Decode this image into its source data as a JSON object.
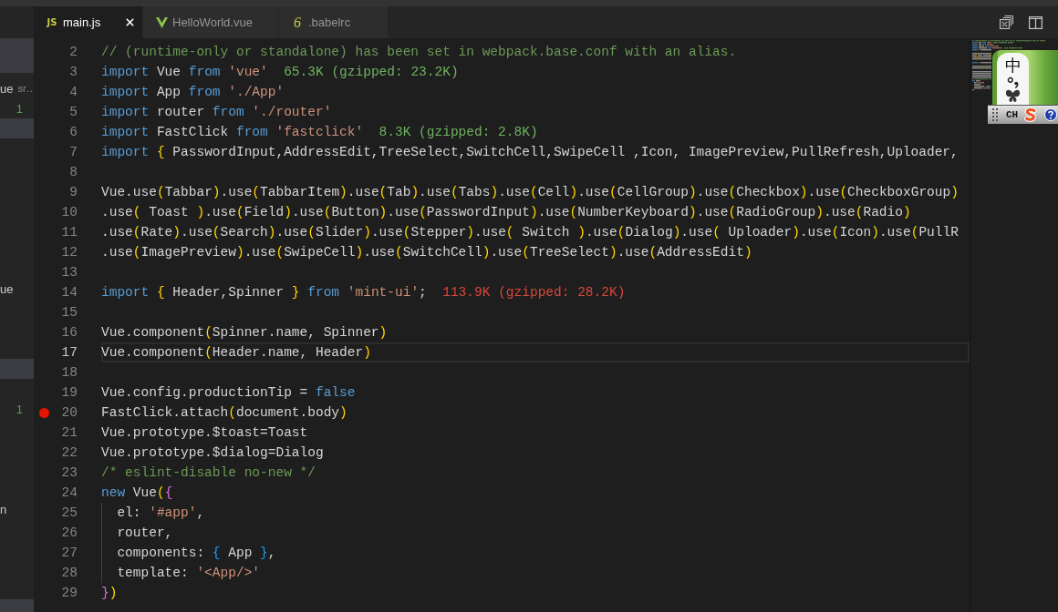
{
  "sidebar": {
    "items": [
      {
        "label": "ue",
        "detail": "sr…",
        "selected": false
      },
      {
        "count": "1",
        "selected": false
      },
      {
        "selected": true
      },
      {
        "selected": false
      },
      {
        "selected": false
      },
      {
        "selected": false
      },
      {
        "selected": false
      },
      {
        "selected": false
      },
      {
        "selected": false
      },
      {
        "selected": false
      },
      {
        "label": "ue",
        "selected": false
      },
      {
        "selected": false
      },
      {
        "selected": false
      },
      {
        "selected": false
      },
      {
        "selected": true
      },
      {
        "selected": false
      },
      {
        "count": "1",
        "selected": false
      },
      {
        "selected": false
      },
      {
        "selected": false
      },
      {
        "selected": false
      },
      {
        "selected": false
      },
      {
        "label": "n",
        "selected": false
      },
      {
        "selected": false
      },
      {
        "selected": false
      },
      {
        "selected": false
      },
      {
        "selected": false
      },
      {
        "selected": true
      }
    ]
  },
  "tabs": [
    {
      "label": "main.js",
      "kind": "js",
      "icon_text": "JS",
      "selected": true
    },
    {
      "label": "HelloWorld.vue",
      "kind": "vue",
      "selected": false
    },
    {
      "label": ".babelrc",
      "kind": "babel",
      "icon_text": "6",
      "selected": false
    }
  ],
  "editor": {
    "lines": [
      {
        "number": "2",
        "current": false,
        "breakpoint": false,
        "indent_guide": false,
        "tokens": [
          {
            "text": "// (runtime-only or standalone) has been set in webpack.base.conf with an alias.",
            "kind": "comment"
          }
        ]
      },
      {
        "number": "3",
        "current": false,
        "breakpoint": false,
        "indent_guide": false,
        "tokens": [
          {
            "text": "import",
            "kind": "keyword"
          },
          {
            "text": " Vue ",
            "kind": "plain"
          },
          {
            "text": "from ",
            "kind": "keyword"
          },
          {
            "text": "'vue'",
            "kind": "string"
          },
          {
            "text": "  65.3K (gzipped: 23.2K)",
            "kind": "cost"
          }
        ]
      },
      {
        "number": "4",
        "current": false,
        "breakpoint": false,
        "indent_guide": false,
        "tokens": [
          {
            "text": "import",
            "kind": "keyword"
          },
          {
            "text": " App ",
            "kind": "plain"
          },
          {
            "text": "from ",
            "kind": "keyword"
          },
          {
            "text": "'./App'",
            "kind": "string"
          }
        ]
      },
      {
        "number": "5",
        "current": false,
        "breakpoint": false,
        "indent_guide": false,
        "tokens": [
          {
            "text": "import",
            "kind": "keyword"
          },
          {
            "text": " router ",
            "kind": "plain"
          },
          {
            "text": "from ",
            "kind": "keyword"
          },
          {
            "text": "'./router'",
            "kind": "string"
          }
        ]
      },
      {
        "number": "6",
        "current": false,
        "breakpoint": false,
        "indent_guide": false,
        "tokens": [
          {
            "text": "import",
            "kind": "keyword"
          },
          {
            "text": " FastClick ",
            "kind": "plain"
          },
          {
            "text": "from ",
            "kind": "keyword"
          },
          {
            "text": "'fastclick'",
            "kind": "string"
          },
          {
            "text": "  8.3K (gzipped: 2.8K)",
            "kind": "cost"
          }
        ]
      },
      {
        "number": "7",
        "current": false,
        "breakpoint": false,
        "indent_guide": false,
        "tokens": [
          {
            "text": "import ",
            "kind": "keyword"
          },
          {
            "text": "{",
            "kind": "outer"
          },
          {
            "text": " PasswordInput,AddressEdit,TreeSelect,SwitchCell,SwipeCell ,Icon, ImagePreview,PullRefresh,Uploader,",
            "kind": "plain"
          }
        ]
      },
      {
        "number": "8",
        "current": false,
        "breakpoint": false,
        "indent_guide": false
      },
      {
        "number": "9",
        "current": false,
        "breakpoint": false,
        "indent_guide": false,
        "tokens": [
          {
            "text": "Vue.use",
            "kind": "plain"
          },
          {
            "text": "(",
            "kind": "outer"
          },
          {
            "text": "Tabbar",
            "kind": "plain"
          },
          {
            "text": ")",
            "kind": "outer"
          },
          {
            "text": ".use",
            "kind": "plain"
          },
          {
            "text": "(",
            "kind": "outer"
          },
          {
            "text": "TabbarItem",
            "kind": "plain"
          },
          {
            "text": ")",
            "kind": "outer"
          },
          {
            "text": ".use",
            "kind": "plain"
          },
          {
            "text": "(",
            "kind": "outer"
          },
          {
            "text": "Tab",
            "kind": "plain"
          },
          {
            "text": ")",
            "kind": "outer"
          },
          {
            "text": ".use",
            "kind": "plain"
          },
          {
            "text": "(",
            "kind": "outer"
          },
          {
            "text": "Tabs",
            "kind": "plain"
          },
          {
            "text": ")",
            "kind": "outer"
          },
          {
            "text": ".use",
            "kind": "plain"
          },
          {
            "text": "(",
            "kind": "outer"
          },
          {
            "text": "Cell",
            "kind": "plain"
          },
          {
            "text": ")",
            "kind": "outer"
          },
          {
            "text": ".use",
            "kind": "plain"
          },
          {
            "text": "(",
            "kind": "outer"
          },
          {
            "text": "CellGroup",
            "kind": "plain"
          },
          {
            "text": ")",
            "kind": "outer"
          },
          {
            "text": ".use",
            "kind": "plain"
          },
          {
            "text": "(",
            "kind": "outer"
          },
          {
            "text": "Checkbox",
            "kind": "plain"
          },
          {
            "text": ")",
            "kind": "outer"
          },
          {
            "text": ".use",
            "kind": "plain"
          },
          {
            "text": "(",
            "kind": "outer"
          },
          {
            "text": "CheckboxGroup",
            "kind": "plain"
          },
          {
            "text": ")",
            "kind": "outer"
          }
        ]
      },
      {
        "number": "10",
        "current": false,
        "breakpoint": false,
        "indent_guide": false,
        "tokens": [
          {
            "text": ".use",
            "kind": "plain"
          },
          {
            "text": "(",
            "kind": "outer"
          },
          {
            "text": " Toast ",
            "kind": "plain"
          },
          {
            "text": ")",
            "kind": "outer"
          },
          {
            "text": ".use",
            "kind": "plain"
          },
          {
            "text": "(",
            "kind": "outer"
          },
          {
            "text": "Field",
            "kind": "plain"
          },
          {
            "text": ")",
            "kind": "outer"
          },
          {
            "text": ".use",
            "kind": "plain"
          },
          {
            "text": "(",
            "kind": "outer"
          },
          {
            "text": "Button",
            "kind": "plain"
          },
          {
            "text": ")",
            "kind": "outer"
          },
          {
            "text": ".use",
            "kind": "plain"
          },
          {
            "text": "(",
            "kind": "outer"
          },
          {
            "text": "PasswordInput",
            "kind": "plain"
          },
          {
            "text": ")",
            "kind": "outer"
          },
          {
            "text": ".use",
            "kind": "plain"
          },
          {
            "text": "(",
            "kind": "outer"
          },
          {
            "text": "NumberKeyboard",
            "kind": "plain"
          },
          {
            "text": ")",
            "kind": "outer"
          },
          {
            "text": ".use",
            "kind": "plain"
          },
          {
            "text": "(",
            "kind": "outer"
          },
          {
            "text": "RadioGroup",
            "kind": "plain"
          },
          {
            "text": ")",
            "kind": "outer"
          },
          {
            "text": ".use",
            "kind": "plain"
          },
          {
            "text": "(",
            "kind": "outer"
          },
          {
            "text": "Radio",
            "kind": "plain"
          },
          {
            "text": ")",
            "kind": "outer"
          }
        ]
      },
      {
        "number": "11",
        "current": false,
        "breakpoint": false,
        "indent_guide": false,
        "tokens": [
          {
            "text": ".use",
            "kind": "plain"
          },
          {
            "text": "(",
            "kind": "outer"
          },
          {
            "text": "Rate",
            "kind": "plain"
          },
          {
            "text": ")",
            "kind": "outer"
          },
          {
            "text": ".use",
            "kind": "plain"
          },
          {
            "text": "(",
            "kind": "outer"
          },
          {
            "text": "Search",
            "kind": "plain"
          },
          {
            "text": ")",
            "kind": "outer"
          },
          {
            "text": ".use",
            "kind": "plain"
          },
          {
            "text": "(",
            "kind": "outer"
          },
          {
            "text": "Slider",
            "kind": "plain"
          },
          {
            "text": ")",
            "kind": "outer"
          },
          {
            "text": ".use",
            "kind": "plain"
          },
          {
            "text": "(",
            "kind": "outer"
          },
          {
            "text": "Stepper",
            "kind": "plain"
          },
          {
            "text": ")",
            "kind": "outer"
          },
          {
            "text": ".use",
            "kind": "plain"
          },
          {
            "text": "(",
            "kind": "outer"
          },
          {
            "text": " Switch ",
            "kind": "plain"
          },
          {
            "text": ")",
            "kind": "outer"
          },
          {
            "text": ".use",
            "kind": "plain"
          },
          {
            "text": "(",
            "kind": "outer"
          },
          {
            "text": "Dialog",
            "kind": "plain"
          },
          {
            "text": ")",
            "kind": "outer"
          },
          {
            "text": ".use",
            "kind": "plain"
          },
          {
            "text": "(",
            "kind": "outer"
          },
          {
            "text": " Uploader",
            "kind": "plain"
          },
          {
            "text": ")",
            "kind": "outer"
          },
          {
            "text": ".use",
            "kind": "plain"
          },
          {
            "text": "(",
            "kind": "outer"
          },
          {
            "text": "Icon",
            "kind": "plain"
          },
          {
            "text": ")",
            "kind": "outer"
          },
          {
            "text": ".use",
            "kind": "plain"
          },
          {
            "text": "(",
            "kind": "outer"
          },
          {
            "text": "PullR",
            "kind": "plain"
          }
        ]
      },
      {
        "number": "12",
        "current": false,
        "breakpoint": false,
        "indent_guide": false,
        "tokens": [
          {
            "text": ".use",
            "kind": "plain"
          },
          {
            "text": "(",
            "kind": "outer"
          },
          {
            "text": "ImagePreview",
            "kind": "plain"
          },
          {
            "text": ")",
            "kind": "outer"
          },
          {
            "text": ".use",
            "kind": "plain"
          },
          {
            "text": "(",
            "kind": "outer"
          },
          {
            "text": "SwipeCell",
            "kind": "plain"
          },
          {
            "text": ")",
            "kind": "outer"
          },
          {
            "text": ".use",
            "kind": "plain"
          },
          {
            "text": "(",
            "kind": "outer"
          },
          {
            "text": "SwitchCell",
            "kind": "plain"
          },
          {
            "text": ")",
            "kind": "outer"
          },
          {
            "text": ".use",
            "kind": "plain"
          },
          {
            "text": "(",
            "kind": "outer"
          },
          {
            "text": "TreeSelect",
            "kind": "plain"
          },
          {
            "text": ")",
            "kind": "outer"
          },
          {
            "text": ".use",
            "kind": "plain"
          },
          {
            "text": "(",
            "kind": "outer"
          },
          {
            "text": "AddressEdit",
            "kind": "plain"
          },
          {
            "text": ")",
            "kind": "outer"
          }
        ]
      },
      {
        "number": "13",
        "current": false,
        "breakpoint": false,
        "indent_guide": false
      },
      {
        "number": "14",
        "current": false,
        "breakpoint": false,
        "indent_guide": false,
        "tokens": [
          {
            "text": "import ",
            "kind": "keyword"
          },
          {
            "text": "{",
            "kind": "outer"
          },
          {
            "text": " Header,Spinner ",
            "kind": "plain"
          },
          {
            "text": "}",
            "kind": "outer"
          },
          {
            "text": " from ",
            "kind": "keyword"
          },
          {
            "text": "'mint-ui'",
            "kind": "string"
          },
          {
            "text": ";",
            "kind": "plain"
          },
          {
            "text": "  113.9K (gzipped: 28.2K)",
            "kind": "warning"
          }
        ]
      },
      {
        "number": "15",
        "current": false,
        "breakpoint": false,
        "indent_guide": false
      },
      {
        "number": "16",
        "current": false,
        "breakpoint": false,
        "indent_guide": false,
        "tokens": [
          {
            "text": "Vue.component",
            "kind": "plain"
          },
          {
            "text": "(",
            "kind": "outer"
          },
          {
            "text": "Spinner.name, Spinner",
            "kind": "plain"
          },
          {
            "text": ")",
            "kind": "outer"
          }
        ]
      },
      {
        "number": "17",
        "current": true,
        "breakpoint": false,
        "indent_guide": false,
        "tokens": [
          {
            "text": "Vue.component",
            "kind": "plain"
          },
          {
            "text": "(",
            "kind": "outer"
          },
          {
            "text": "Header.name, Header",
            "kind": "plain"
          },
          {
            "text": ")",
            "kind": "outer"
          }
        ]
      },
      {
        "number": "18",
        "current": false,
        "breakpoint": false,
        "indent_guide": false
      },
      {
        "number": "19",
        "current": false,
        "breakpoint": false,
        "indent_guide": false,
        "tokens": [
          {
            "text": "Vue.config.productionTip = ",
            "kind": "plain"
          },
          {
            "text": "false",
            "kind": "keyword"
          }
        ]
      },
      {
        "number": "20",
        "current": false,
        "breakpoint": true,
        "indent_guide": false,
        "tokens": [
          {
            "text": "FastClick.attach",
            "kind": "plain"
          },
          {
            "text": "(",
            "kind": "outer"
          },
          {
            "text": "document.body",
            "kind": "plain"
          },
          {
            "text": ")",
            "kind": "outer"
          }
        ]
      },
      {
        "number": "21",
        "current": false,
        "breakpoint": false,
        "indent_guide": false,
        "tokens": [
          {
            "text": "Vue.prototype.$toast=Toast",
            "kind": "plain"
          }
        ]
      },
      {
        "number": "22",
        "current": false,
        "breakpoint": false,
        "indent_guide": false,
        "tokens": [
          {
            "text": "Vue.prototype.$dialog=Dialog",
            "kind": "plain"
          }
        ]
      },
      {
        "number": "23",
        "current": false,
        "breakpoint": false,
        "indent_guide": false,
        "tokens": [
          {
            "text": "/* eslint-disable no-new */",
            "kind": "comment"
          }
        ]
      },
      {
        "number": "24",
        "current": false,
        "breakpoint": false,
        "indent_guide": false,
        "tokens": [
          {
            "text": "new",
            "kind": "keyword"
          },
          {
            "text": " Vue",
            "kind": "plain"
          },
          {
            "text": "(",
            "kind": "outer"
          },
          {
            "text": "{",
            "kind": "middle"
          }
        ]
      },
      {
        "number": "25",
        "current": false,
        "breakpoint": false,
        "indent_guide": true,
        "tokens": [
          {
            "text": "  el: ",
            "kind": "plain"
          },
          {
            "text": "'#app'",
            "kind": "string"
          },
          {
            "text": ",",
            "kind": "plain"
          }
        ]
      },
      {
        "number": "26",
        "current": false,
        "breakpoint": false,
        "indent_guide": true,
        "tokens": [
          {
            "text": "  router,",
            "kind": "plain"
          }
        ]
      },
      {
        "number": "27",
        "current": false,
        "breakpoint": false,
        "indent_guide": true,
        "tokens": [
          {
            "text": "  components: ",
            "kind": "plain"
          },
          {
            "text": "{",
            "kind": "inner"
          },
          {
            "text": " App ",
            "kind": "plain"
          },
          {
            "text": "}",
            "kind": "inner"
          },
          {
            "text": ",",
            "kind": "plain"
          }
        ]
      },
      {
        "number": "28",
        "current": false,
        "breakpoint": false,
        "indent_guide": true,
        "tokens": [
          {
            "text": "  template: ",
            "kind": "plain"
          },
          {
            "text": "'<App/>'",
            "kind": "string"
          }
        ]
      },
      {
        "number": "29",
        "current": false,
        "breakpoint": false,
        "indent_guide": false,
        "tokens": [
          {
            "text": "}",
            "kind": "middle"
          },
          {
            "text": ")",
            "kind": "outer"
          }
        ]
      }
    ]
  },
  "ime_toolbar": {
    "mode": "中",
    "language": "CH"
  }
}
